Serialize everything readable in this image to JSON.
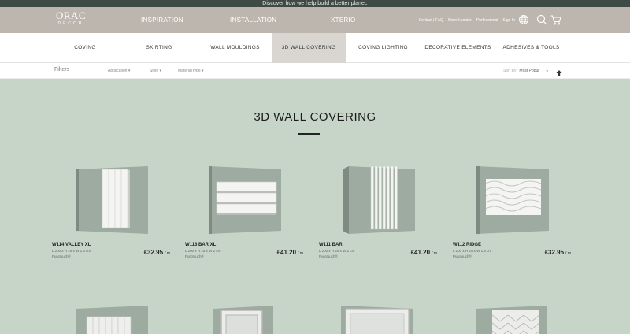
{
  "announcement": "Discover how we help build a better planet.",
  "brand": {
    "line1": "ORAC",
    "line2": "DECOR"
  },
  "main_nav": [
    "INSPIRATION",
    "INSTALLATION",
    "XTERIO"
  ],
  "utility_links": [
    "Contact | FAQ",
    "Store Locator",
    "Professional",
    "Sign In"
  ],
  "icons": [
    "globe-icon",
    "search-icon",
    "cart-icon"
  ],
  "categories": [
    {
      "label": "COVING",
      "active": false
    },
    {
      "label": "SKIRTING",
      "active": false
    },
    {
      "label": "WALL MOULDINGS",
      "active": false
    },
    {
      "label": "3D WALL COVERING",
      "active": true
    },
    {
      "label": "COVING LIGHTING",
      "active": false
    },
    {
      "label": "DECORATIVE ELEMENTS",
      "active": false
    },
    {
      "label": "ADHESIVES & TOOLS",
      "active": false
    }
  ],
  "filters": {
    "label": "Filters",
    "dropdowns": [
      "Application",
      "Style",
      "Material type"
    ],
    "sort_label": "Sort By",
    "sort_value": "Most Popul"
  },
  "page_title": "3D WALL COVERING",
  "products": [
    {
      "name": "W114 VALLEY XL",
      "dims": "L 200 x H 25 x W 1.3 cm",
      "material": "Purotouch®",
      "price": "£32.95",
      "unit": "/ m"
    },
    {
      "name": "W116 BAR XL",
      "dims": "L 200 x H 25 x W 2 cm",
      "material": "Purotouch®",
      "price": "£41.20",
      "unit": "/ m"
    },
    {
      "name": "W111 BAR",
      "dims": "L 200 x H 25 x W 2 cm",
      "material": "Purotouch®",
      "price": "£41.20",
      "unit": "/ m"
    },
    {
      "name": "W112 RIDGE",
      "dims": "L 200 x H 25 x W 1.9 cm",
      "material": "Purotouch®",
      "price": "£32.95",
      "unit": "/ m"
    }
  ],
  "colors": {
    "page_bg": "#c7d5c8",
    "header_bg": "#bdb6ae",
    "announce_bg": "#3f4a44",
    "wall": "#9eaba0",
    "panel": "#f4f4f2"
  }
}
